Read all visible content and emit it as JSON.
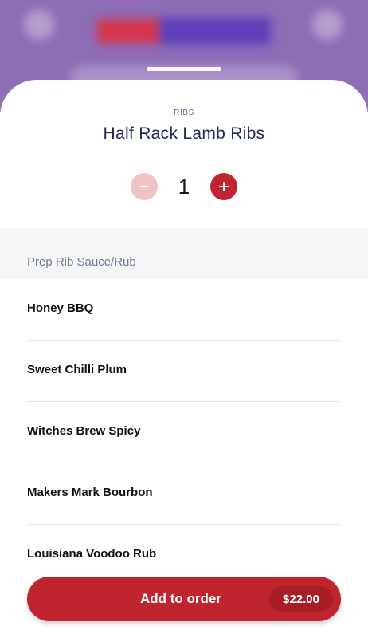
{
  "item": {
    "category": "RIBS",
    "title": "Half Rack Lamb Ribs",
    "quantity": "1"
  },
  "stepper": {
    "minus_icon": "minus-icon",
    "plus_icon": "plus-icon"
  },
  "group": {
    "title": "Prep Rib Sauce/Rub",
    "options": [
      "Honey BBQ",
      "Sweet Chilli Plum",
      "Witches Brew Spicy",
      "Makers Mark Bourbon",
      "Louisiana Voodoo Rub"
    ]
  },
  "cart": {
    "add_label": "Add to order",
    "price": "$22.00"
  },
  "colors": {
    "accent": "#c0242e",
    "accent_light": "#efc3c6",
    "header_bg": "#8e6cb6",
    "title": "#1f2a55"
  }
}
